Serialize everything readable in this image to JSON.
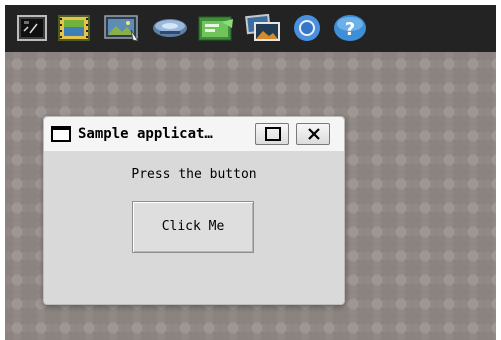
{
  "taskbar": {
    "launchers": [
      {
        "icon": "terminal-icon"
      },
      {
        "icon": "film-strip-icon"
      },
      {
        "icon": "image-viewer-icon"
      },
      {
        "icon": "disk-drive-icon"
      },
      {
        "icon": "web-browser-icon"
      },
      {
        "icon": "photo-manager-icon"
      },
      {
        "icon": "chromium-icon"
      },
      {
        "icon": "help-icon"
      }
    ]
  },
  "window": {
    "title": "Sample applicat…",
    "title_icon": "window-icon",
    "maximize_icon": "maximize-icon",
    "close_icon": "close-icon"
  },
  "content": {
    "prompt": "Press the button",
    "button_label": "Click Me"
  },
  "colors": {
    "taskbar": "#232323",
    "desktop": "#8b8380",
    "window_bg": "#d9d9d9",
    "titlebar_bg": "#f5f5f5"
  }
}
